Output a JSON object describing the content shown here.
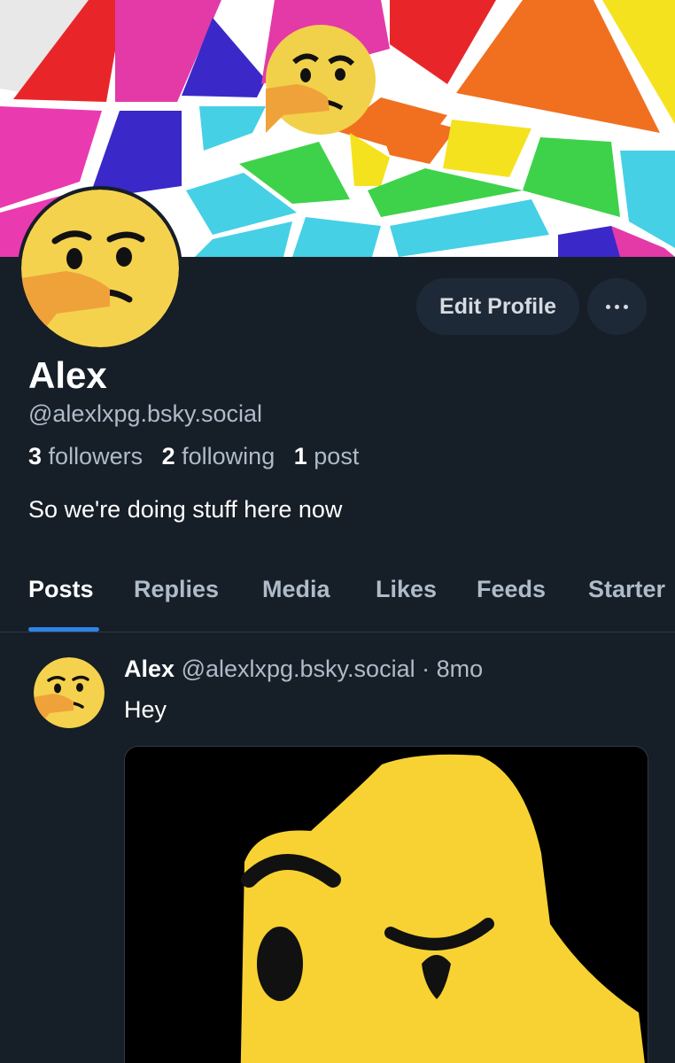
{
  "profile": {
    "display_name": "Alex",
    "handle": "@alexlxpg.bsky.social",
    "followers_count": "3",
    "followers_label": "followers",
    "following_count": "2",
    "following_label": "following",
    "posts_count": "1",
    "posts_label": "post",
    "bio": "So we're doing stuff here now",
    "edit_button": "Edit Profile",
    "more_icon": "ellipsis-icon"
  },
  "tabs": [
    {
      "label": "Posts",
      "active": true
    },
    {
      "label": "Replies",
      "active": false
    },
    {
      "label": "Media",
      "active": false
    },
    {
      "label": "Likes",
      "active": false
    },
    {
      "label": "Feeds",
      "active": false
    },
    {
      "label": "Starter",
      "active": false
    }
  ],
  "post": {
    "author": "Alex",
    "handle": "@alexlxpg.bsky.social",
    "separator": "·",
    "time": "8mo",
    "text": "Hey",
    "image": "thinking-face-closeup"
  },
  "colors": {
    "background": "#161e27",
    "accent": "#2f84e6",
    "muted_text": "#aebbc9",
    "button_bg": "#1e2937"
  }
}
